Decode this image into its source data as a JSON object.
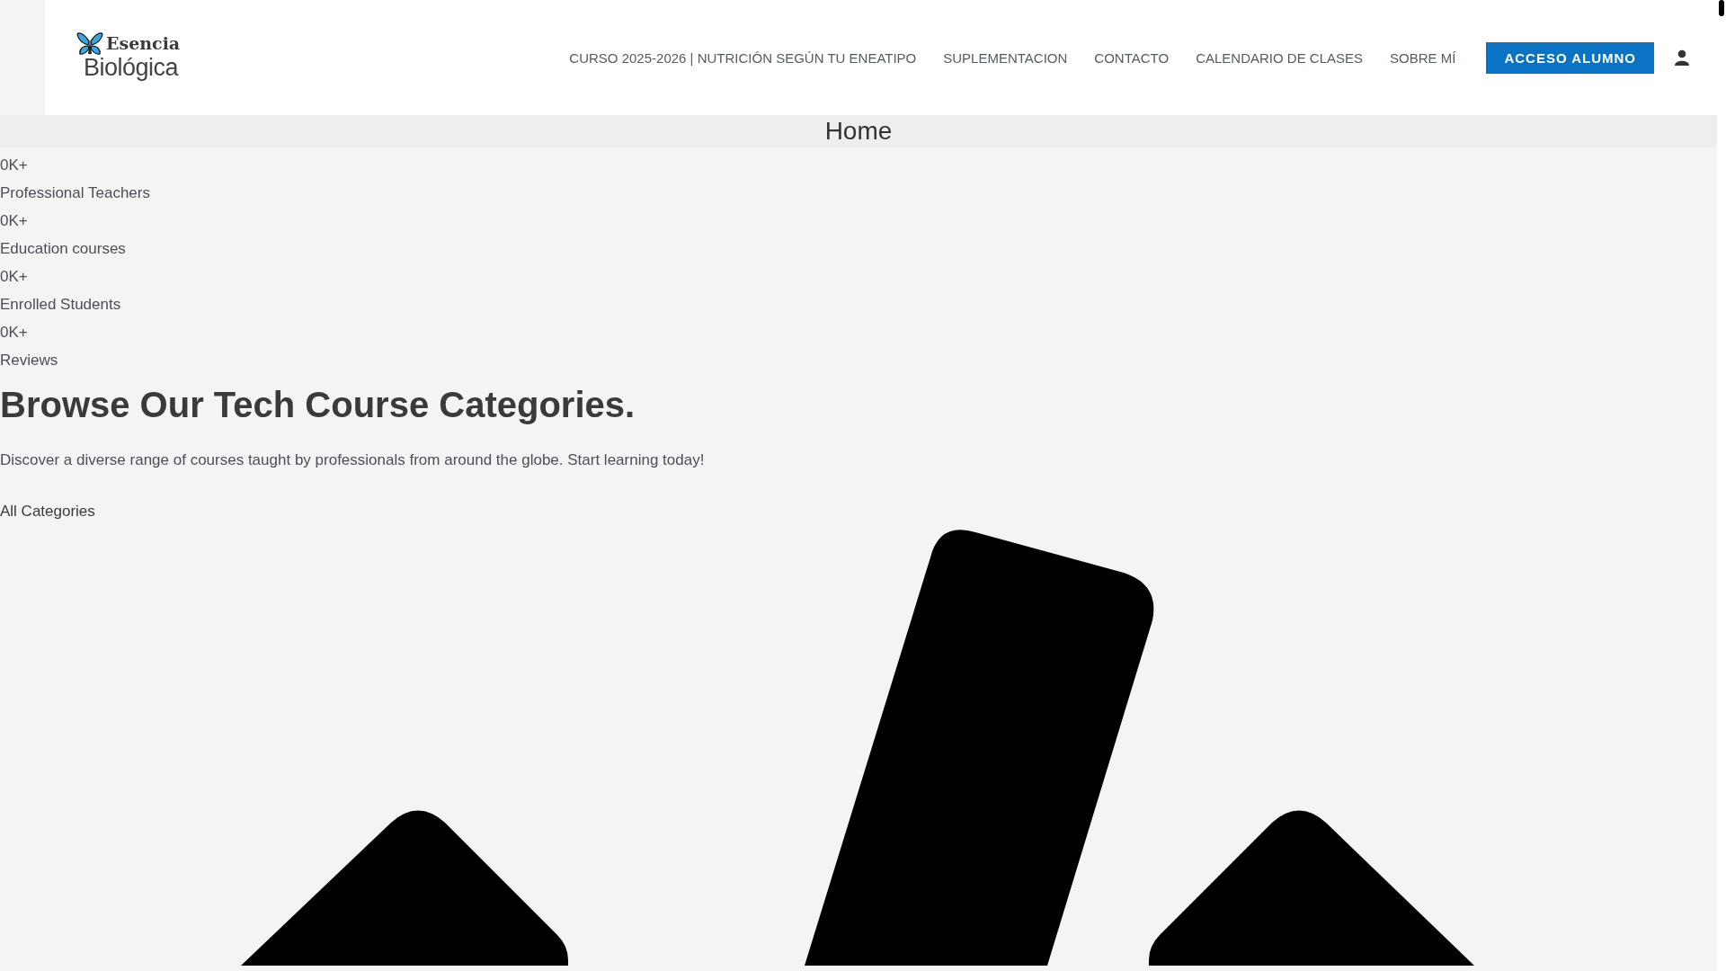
{
  "header": {
    "logo": {
      "line_1": "Esencia",
      "line_2": "Biológica"
    },
    "nav": [
      "CURSO 2025-2026 | NUTRICIÓN SEGÚN TU ENEATIPO",
      "SUPLEMENTACION",
      "CONTACTO",
      "CALENDARIO DE CLASES",
      "SOBRE MÍ"
    ],
    "button": "ACCESO ALUMNO"
  },
  "page_title": "Home",
  "stats": [
    {
      "value": "0K+",
      "label": "Professional Teachers"
    },
    {
      "value": "0K+",
      "label": "Education courses"
    },
    {
      "value": "0K+",
      "label": "Enrolled Students"
    },
    {
      "value": "0K+",
      "label": "Reviews"
    }
  ],
  "heading": "Browse Our Tech Course Categories.",
  "description": "Discover a diverse range of courses taught by professionals from around the globe. Start learning today!",
  "link": "All Categories"
}
